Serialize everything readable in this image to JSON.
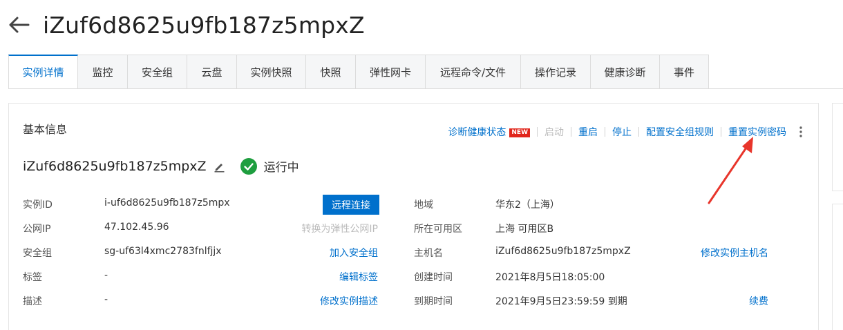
{
  "header": {
    "title": "iZuf6d8625u9fb187z5mpxZ"
  },
  "tabs": [
    {
      "label": "实例详情",
      "active": true
    },
    {
      "label": "监控"
    },
    {
      "label": "安全组"
    },
    {
      "label": "云盘"
    },
    {
      "label": "实例快照"
    },
    {
      "label": "快照"
    },
    {
      "label": "弹性网卡"
    },
    {
      "label": "远程命令/文件"
    },
    {
      "label": "操作记录"
    },
    {
      "label": "健康诊断"
    },
    {
      "label": "事件"
    }
  ],
  "basic_info": {
    "title": "基本信息",
    "actions": {
      "diagnose": "诊断健康状态",
      "new_badge": "NEW",
      "start": "启动",
      "restart": "重启",
      "stop": "停止",
      "sg_rules": "配置安全组规则",
      "reset_password": "重置实例密码"
    },
    "instance_name": "iZuf6d8625u9fb187z5mpxZ",
    "status": "运行中",
    "status_color": "#1e9e3f",
    "left_fields": [
      {
        "label": "实例ID",
        "value": "i-uf6d8625u9fb187z5mpx",
        "action": "远程连接"
      },
      {
        "label": "公网IP",
        "value": "47.102.45.96",
        "action": "转换为弹性公网IP"
      },
      {
        "label": "安全组",
        "value": "sg-uf63l4xmc2783fnlfjjx",
        "action": "加入安全组"
      },
      {
        "label": "标签",
        "value": "-",
        "action": "编辑标签"
      },
      {
        "label": "描述",
        "value": "-",
        "action": "修改实例描述"
      }
    ],
    "right_fields": [
      {
        "label": "地域",
        "value": "华东2（上海）"
      },
      {
        "label": "所在可用区",
        "value": "上海 可用区B"
      },
      {
        "label": "主机名",
        "value": "iZuf6d8625u9fb187z5mpxZ",
        "action": "修改实例主机名"
      },
      {
        "label": "创建时间",
        "value": "2021年8月5日18:05:00"
      },
      {
        "label": "到期时间",
        "value": "2021年9月5日23:59:59 到期",
        "action": "续费"
      }
    ]
  },
  "colors": {
    "accent": "#0070cc",
    "annotation_arrow": "#e8352b"
  }
}
